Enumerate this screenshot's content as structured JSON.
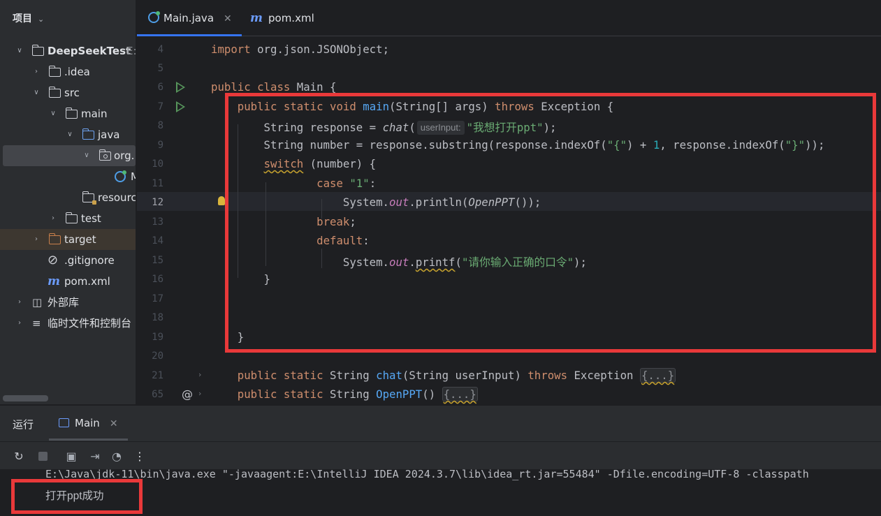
{
  "project_panel": {
    "title": "项目",
    "root_label": "DeepSeekTest",
    "root_suffix": "E:",
    "items": [
      {
        "label": ".idea"
      },
      {
        "label": "src"
      },
      {
        "label": "main"
      },
      {
        "label": "java"
      },
      {
        "label": "org."
      },
      {
        "label": "M"
      },
      {
        "label": "resourc"
      },
      {
        "label": "test"
      },
      {
        "label": "target"
      },
      {
        "label": ".gitignore"
      },
      {
        "label": "pom.xml"
      },
      {
        "label": "外部库"
      },
      {
        "label": "临时文件和控制台"
      }
    ]
  },
  "editor_tabs": [
    {
      "label": "Main.java",
      "active": true,
      "icon": "java-class-icon"
    },
    {
      "label": "pom.xml",
      "active": false,
      "icon": "maven-icon"
    }
  ],
  "code": {
    "current_line": 12,
    "line_numbers": [
      "4",
      "5",
      "6",
      "7",
      "8",
      "9",
      "10",
      "11",
      "12",
      "13",
      "14",
      "15",
      "16",
      "17",
      "18",
      "19",
      "20",
      "21",
      "65"
    ],
    "inlay_hint": "userInput:"
  },
  "run_panel": {
    "title": "运行",
    "tab_label": "Main",
    "console": [
      "E:\\Java\\jdk-11\\bin\\java.exe \"-javaagent:E:\\IntelliJ IDEA 2024.3.7\\lib\\idea_rt.jar=55484\" -Dfile.encoding=UTF-8 -classpath",
      "打开ppt成功"
    ]
  },
  "colors": {
    "highlight_box": "#e9393a",
    "keyword": "#cf8e6d",
    "function": "#56a8f5",
    "string": "#6aab73",
    "accent": "#3574f0"
  }
}
